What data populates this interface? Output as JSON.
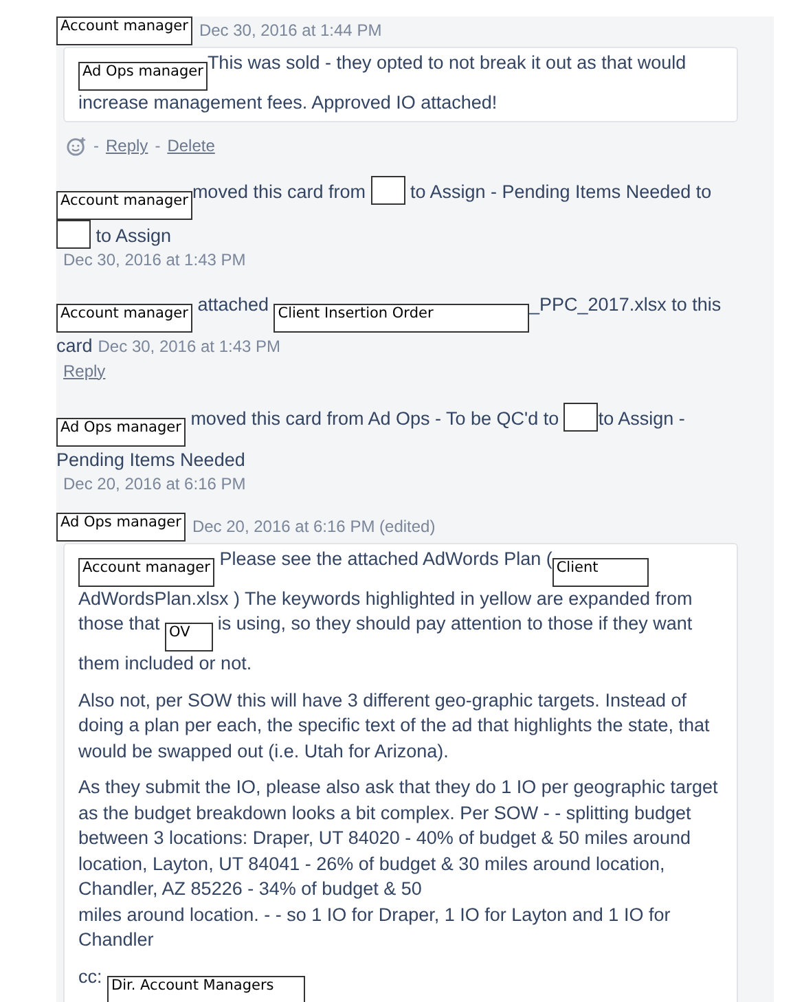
{
  "entries": [
    {
      "kind": "comment",
      "author": "Account manager",
      "time": "Dec 30, 2016 at 1:44 PM",
      "paragraphs": [
        [
          {
            "kind": "redaction",
            "label": "Ad Ops manager"
          },
          {
            "kind": "text",
            "text": "This was sold - they opted to not break it out as that would increase management fees. Approved IO attached!"
          }
        ]
      ],
      "actions": [
        "-",
        "Reply",
        "-",
        "Delete"
      ]
    },
    {
      "kind": "action",
      "segments": [
        {
          "kind": "redaction",
          "label": "Account manager"
        },
        {
          "kind": "text",
          "text": "moved this card from "
        },
        {
          "kind": "redaction"
        },
        {
          "kind": "text",
          "text": " to Assign - Pending Items Needed to "
        },
        {
          "kind": "redaction"
        },
        {
          "kind": "text",
          "text": " to Assign"
        }
      ],
      "time": "Dec 30, 2016 at 1:43 PM",
      "time_inline": false
    },
    {
      "kind": "action",
      "segments": [
        {
          "kind": "redaction",
          "label": "Account manager"
        },
        {
          "kind": "text",
          "text": " attached "
        },
        {
          "kind": "redaction",
          "label": "Client Insertion Order                    "
        },
        {
          "kind": "text",
          "text": "_PPC_2017.xlsx to this card"
        }
      ],
      "time": "Dec 30, 2016 at 1:43 PM",
      "time_inline": true,
      "reply": "Reply"
    },
    {
      "kind": "action",
      "segments": [
        {
          "kind": "redaction",
          "label": "Ad Ops manager"
        },
        {
          "kind": "text",
          "text": " moved this card from Ad Ops - To be QC'd to "
        },
        {
          "kind": "redaction"
        },
        {
          "kind": "text",
          "text": "to Assign - Pending Items Needed"
        }
      ],
      "time": "Dec 20, 2016 at 6:16 PM",
      "time_inline": false
    },
    {
      "kind": "comment",
      "author": "Ad Ops manager",
      "time": "Dec 20, 2016 at 6:16 PM (edited)",
      "paragraphs": [
        [
          {
            "kind": "redaction",
            "label": "Account manager"
          },
          {
            "kind": "text",
            "text": " Please see the attached AdWords Plan ("
          },
          {
            "kind": "redaction",
            "label": "Client          "
          },
          {
            "kind": "text",
            "text": "AdWordsPlan.xlsx ) The keywords highlighted in yellow are expanded from those that "
          },
          {
            "kind": "redaction",
            "label": "OV    "
          },
          {
            "kind": "text",
            "text": " is using, so they should pay attention to those if they want them included or not."
          }
        ],
        [
          {
            "kind": "text",
            "text": "Also not, per SOW this will have 3 different geo-graphic targets. Instead of doing a plan per each, the specific text of the ad that highlights the state, that would be swapped out (i.e. Utah for Arizona)."
          }
        ],
        [
          {
            "kind": "text",
            "text": "As they submit the IO, please also ask that they do 1 IO per geographic target as the budget breakdown looks a bit complex. Per SOW - - splitting budget between 3 locations: Draper, UT 84020 - 40% of budget & 50 miles around location, Layton, UT 84041 - 26% of budget & 30 miles around location, Chandler, AZ 85226 - 34% of budget & 50\nmiles around location. - - so 1 IO for Draper, 1 IO for Layton and 1 IO for Chandler"
          }
        ],
        [
          {
            "kind": "text",
            "text": "cc: "
          },
          {
            "kind": "redaction",
            "label": "Dir. Account Managers      "
          }
        ]
      ]
    }
  ]
}
